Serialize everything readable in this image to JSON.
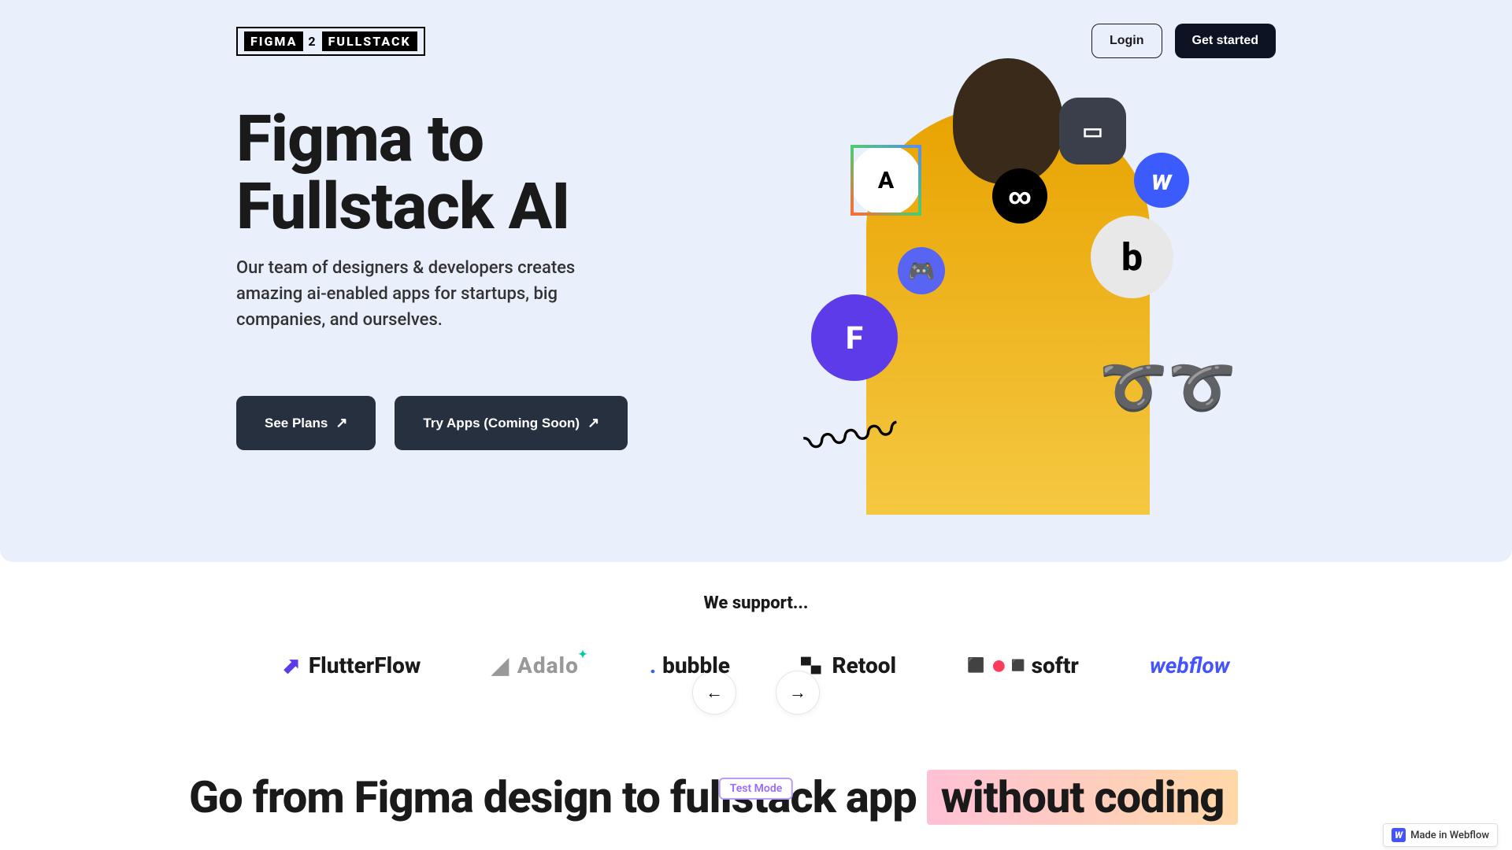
{
  "nav": {
    "logo_part1": "FIGMA",
    "logo_mid": "2",
    "logo_part2": "FULLSTACK",
    "login": "Login",
    "get_started": "Get started"
  },
  "hero": {
    "title": "Figma to Fullstack AI",
    "subtitle": "Our team of designers & developers creates amazing ai-enabled apps for startups, big companies, and ourselves.",
    "see_plans": "See Plans",
    "try_apps": "Try Apps (Coming Soon)"
  },
  "float_icons": {
    "algolia": "A",
    "discord": "🎮",
    "framer": "F",
    "infinity": "∞",
    "window": "▭",
    "webflow_w": "w",
    "bold_b": "b"
  },
  "support": {
    "title": "We support...",
    "flutterflow": "FlutterFlow",
    "adalo": "Adalo",
    "bubble": "bubble",
    "retool": "Retool",
    "softr": "softr",
    "webflow": "webflow"
  },
  "bottom": {
    "heading_pre": "Go from Figma design to fullstack app ",
    "heading_highlight": "without coding",
    "test_mode": "Test Mode"
  },
  "badge": {
    "made_in": "Made in Webflow"
  }
}
